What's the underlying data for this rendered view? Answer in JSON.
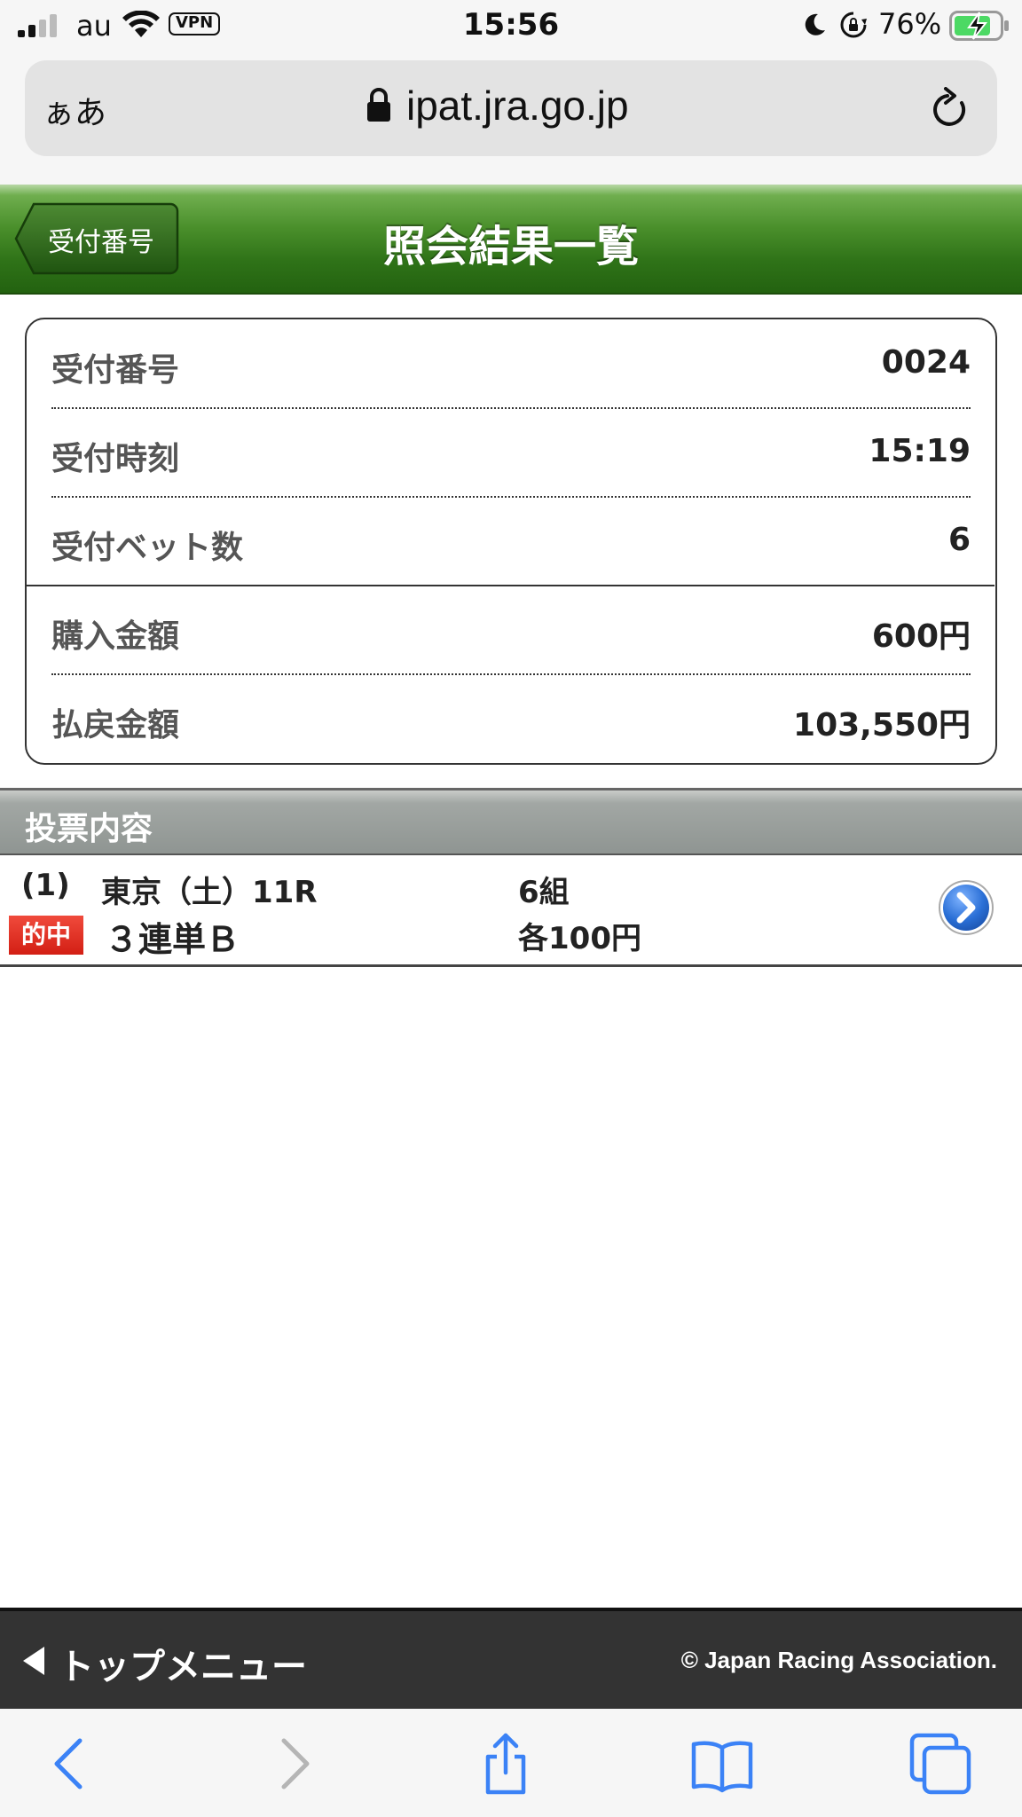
{
  "status_bar": {
    "carrier": "au",
    "vpn": "VPN",
    "time": "15:56",
    "battery_percent": "76%"
  },
  "browser": {
    "text_size_label": "ぁあ",
    "domain": "ipat.jra.go.jp"
  },
  "header": {
    "back_label": "受付番号",
    "title": "照会結果一覧"
  },
  "summary": {
    "rows": [
      {
        "label": "受付番号",
        "value": "0024"
      },
      {
        "label": "受付時刻",
        "value": "15:19"
      },
      {
        "label": "受付ベット数",
        "value": "6"
      },
      {
        "label": "購入金額",
        "value": "600円"
      },
      {
        "label": "払戻金額",
        "value": "103,550円"
      }
    ]
  },
  "section": {
    "title": "投票内容"
  },
  "bets": [
    {
      "index": "(1)",
      "race": "東京（土）11R",
      "combos": "6組",
      "hit": "的中",
      "bet_type": "３連単Ｂ",
      "amount": "各100円"
    }
  ],
  "footer": {
    "top_menu": "トップメニュー",
    "copyright": "© Japan Racing Association."
  },
  "colors": {
    "header_green": "#3a8020",
    "hit_red": "#e03228",
    "arrow_blue": "#2a6fd6",
    "footer_bg": "#333333",
    "ios_blue": "#3b82f6"
  }
}
